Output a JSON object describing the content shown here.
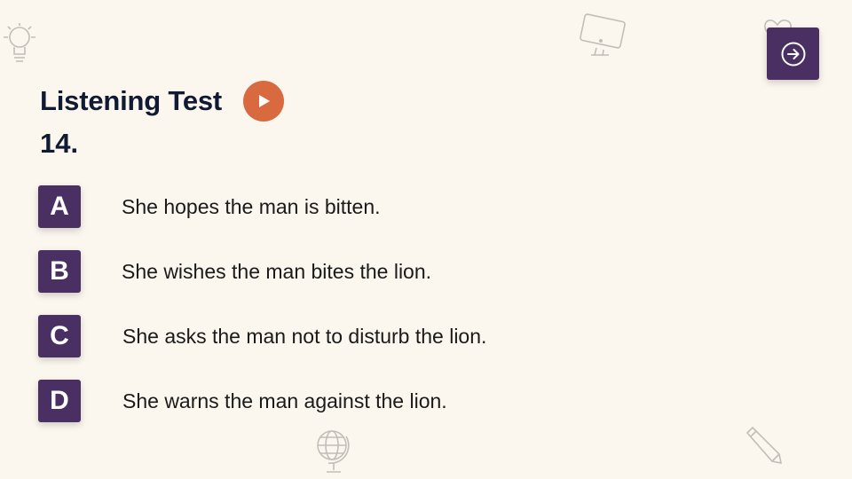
{
  "colors": {
    "accent": "#4a2f63",
    "play": "#d9693f",
    "background": "#fbf7ef"
  },
  "header": {
    "title": "Listening Test"
  },
  "question": {
    "number": "14."
  },
  "options": [
    {
      "letter": "A",
      "text": "She hopes the man is bitten."
    },
    {
      "letter": "B",
      "text": "She wishes the man bites the lion."
    },
    {
      "letter": "C",
      "text": "She asks the man not to disturb the lion."
    },
    {
      "letter": "D",
      "text": "She warns the man against the lion."
    }
  ],
  "icons": {
    "next": "arrow-right-circle-icon",
    "play": "play-icon"
  }
}
